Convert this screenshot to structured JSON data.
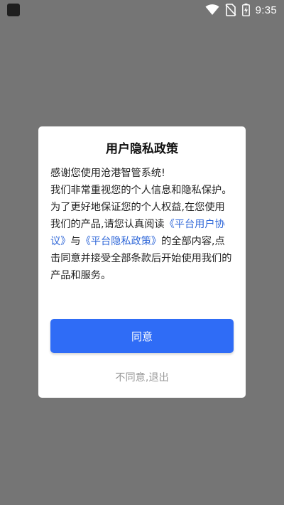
{
  "status_bar": {
    "time": "9:35",
    "icons": [
      "app-icon",
      "wifi-icon",
      "no-sim-icon",
      "battery-charging-icon"
    ]
  },
  "dialog": {
    "title": "用户隐私政策",
    "body": {
      "p1": "感谢您使用沧港智管系统!",
      "p2_a": "我们非常重视您的个人信息和隐私保护。为了更好地保证您的个人权益,在您使用我们的产品,请您认真阅读",
      "user_agreement_link": "《平台用户协议》",
      "p2_b": "与",
      "privacy_policy_link": "《平台隐私政策》",
      "p2_c": "的全部内容,点击同意并接受全部条款后开始使用我们的产品和服务。"
    },
    "agree_label": "同意",
    "disagree_label": "不同意,退出"
  },
  "colors": {
    "overlay": "#757575",
    "accent": "#2f6cf6",
    "link": "#2f67d8",
    "muted": "#9a9a9a"
  }
}
